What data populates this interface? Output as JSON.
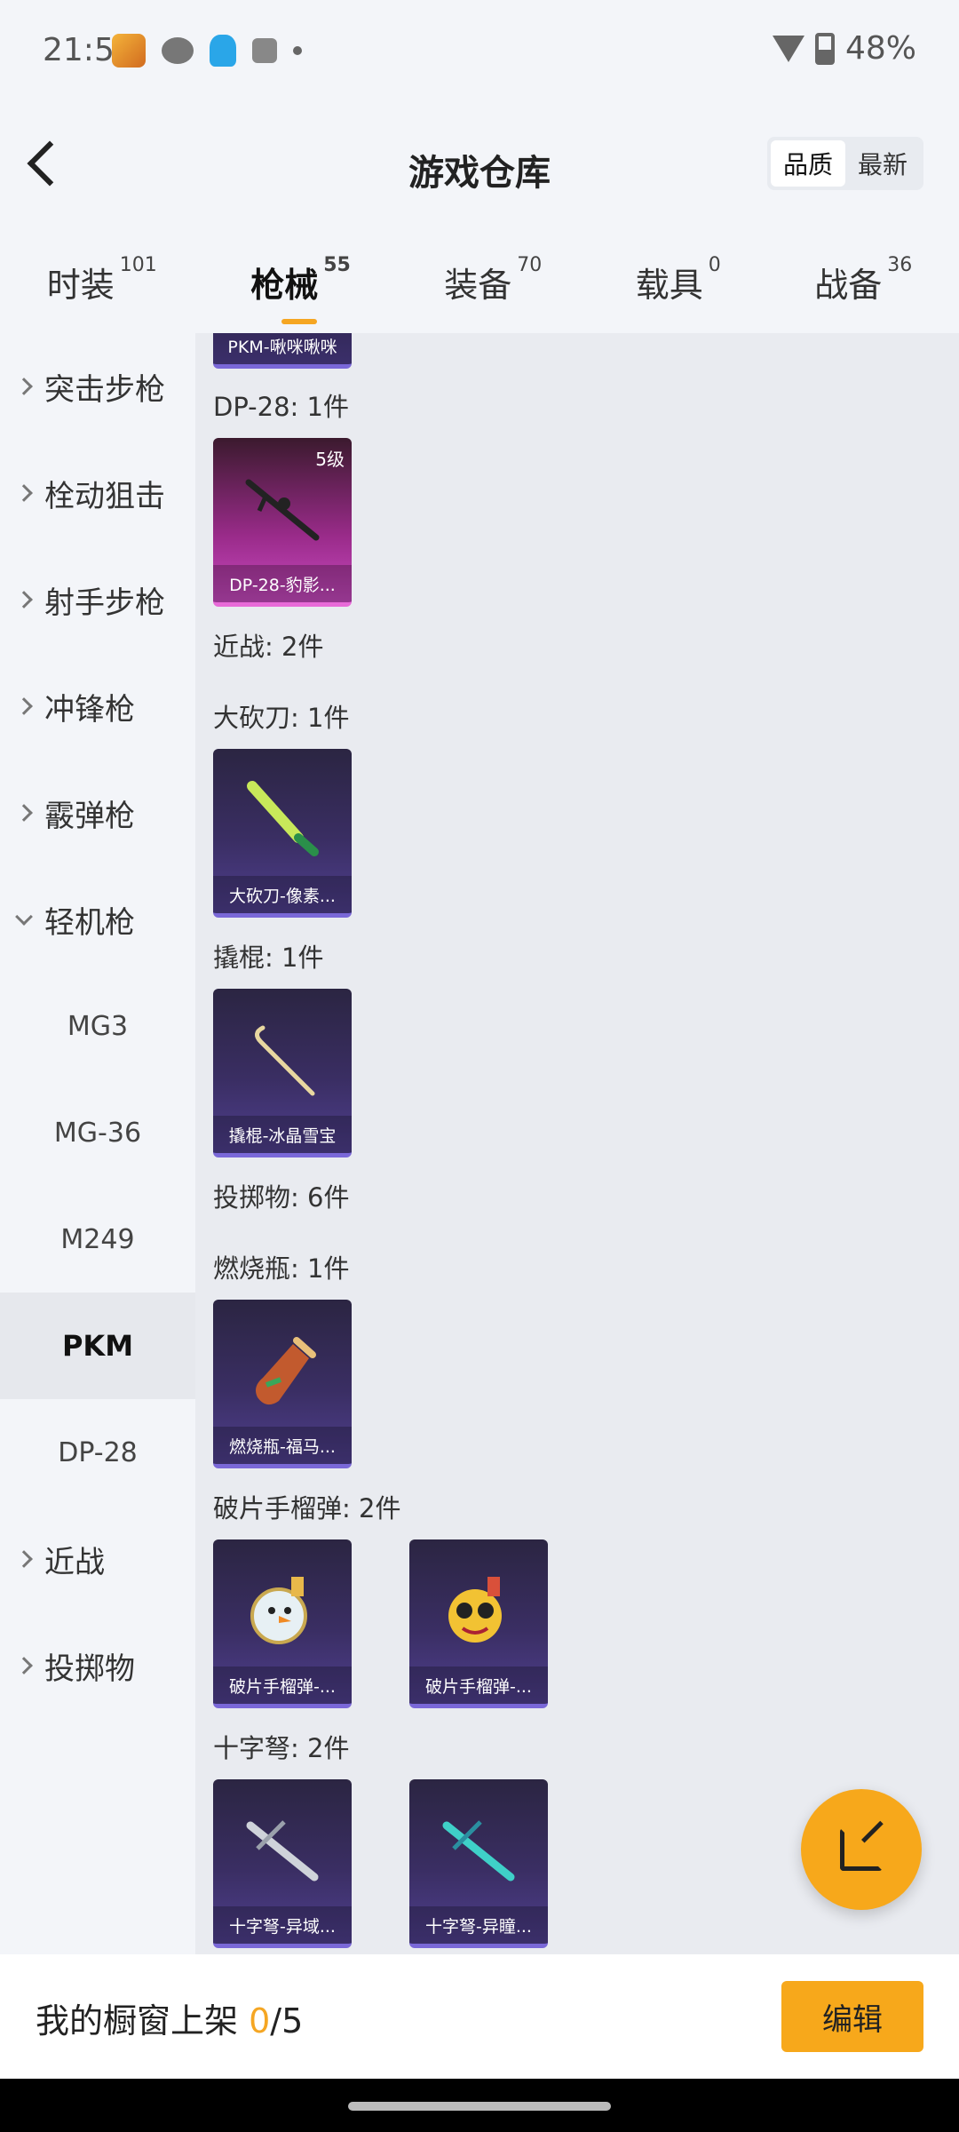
{
  "status": {
    "time": "21:51",
    "battery": "48%"
  },
  "header": {
    "title": "游戏仓库",
    "sort": [
      "品质",
      "最新"
    ]
  },
  "tabs": [
    {
      "label": "时装",
      "count": "101"
    },
    {
      "label": "枪械",
      "count": "55"
    },
    {
      "label": "装备",
      "count": "70"
    },
    {
      "label": "载具",
      "count": "0"
    },
    {
      "label": "战备",
      "count": "36"
    }
  ],
  "sidebar": [
    "突击步枪",
    "栓动狙击",
    "射手步枪",
    "冲锋枪",
    "霰弹枪",
    "轻机枪",
    "MG3",
    "MG-36",
    "M249",
    "PKM",
    "DP-28",
    "近战",
    "投掷物"
  ],
  "content": {
    "top_partial": "PKM-啾咪啾咪",
    "sections": [
      {
        "header": "DP-28: 1件"
      },
      {
        "card": "DP-28-豹影...",
        "level": "5级"
      },
      {
        "header": "近战: 2件"
      },
      {
        "header": "大砍刀: 1件"
      },
      {
        "card": "大砍刀-像素..."
      },
      {
        "header": "撬棍: 1件"
      },
      {
        "card": "撬棍-冰晶雪宝"
      },
      {
        "header": "投掷物: 6件"
      },
      {
        "header": "燃烧瓶: 1件"
      },
      {
        "card": "燃烧瓶-福马..."
      },
      {
        "header": "破片手榴弹: 2件"
      },
      {
        "cards": [
          "破片手榴弹-...",
          "破片手榴弹-..."
        ]
      },
      {
        "header": "十字弩: 2件"
      },
      {
        "cards": [
          "十字弩-异域...",
          "十字弩-异瞳..."
        ]
      }
    ]
  },
  "bottom": {
    "text_prefix": "我的橱窗上架 ",
    "count": "0",
    "total": "/5",
    "edit": "编辑"
  }
}
